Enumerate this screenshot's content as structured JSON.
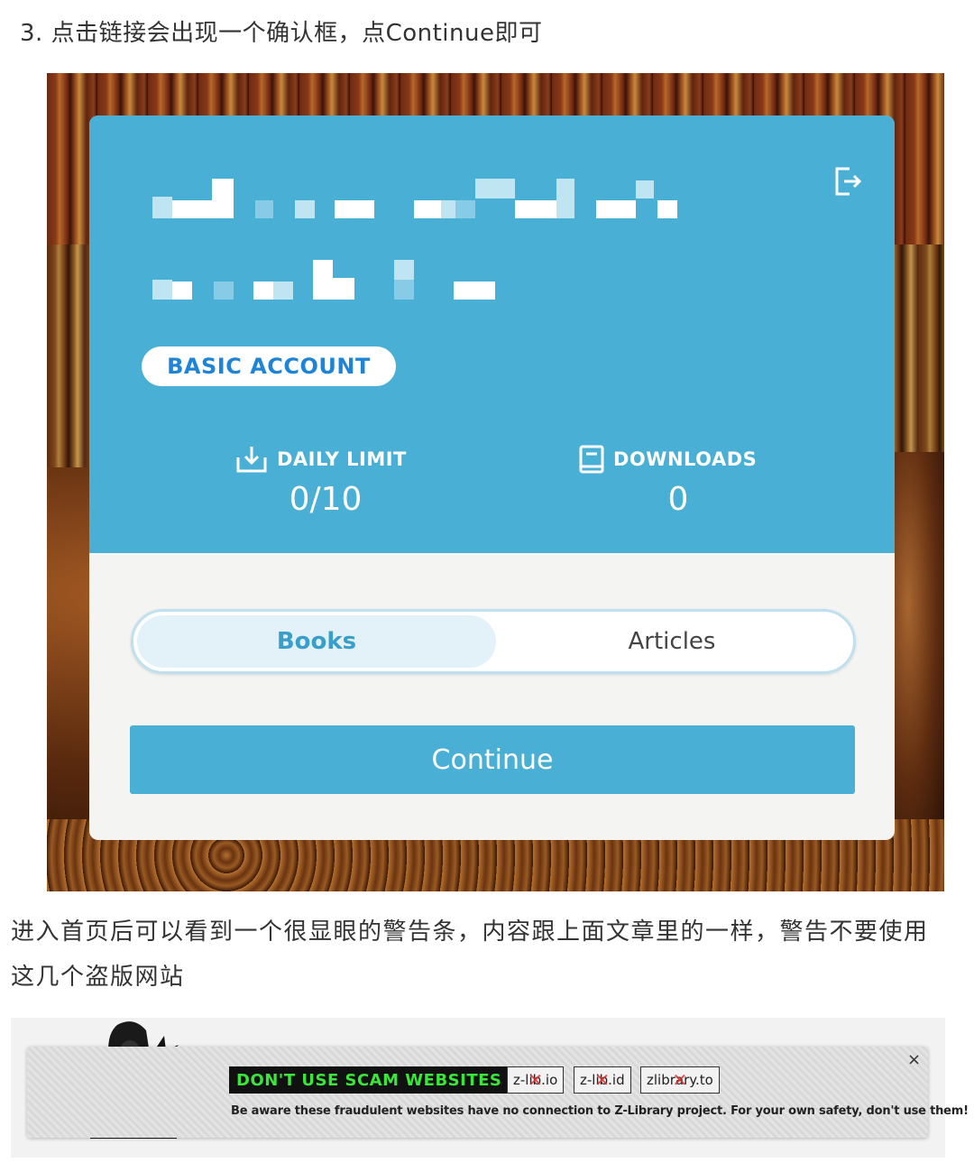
{
  "article": {
    "step_text": "3. 点击链接会出现一个确认框，点Continue即可",
    "paragraph": "进入首页后可以看到一个很显眼的警告条，内容跟上面文章里的一样，警告不要使用这几个盗版网站"
  },
  "dialog": {
    "account_badge": "BASIC ACCOUNT",
    "stats": [
      {
        "label": "DAILY LIMIT",
        "value": "0/10",
        "icon": "download-tray-icon"
      },
      {
        "label": "DOWNLOADS",
        "value": "0",
        "icon": "book-icon"
      }
    ],
    "tabs": [
      {
        "label": "Books",
        "active": true
      },
      {
        "label": "Articles",
        "active": false
      }
    ],
    "continue_label": "Continue",
    "logout_icon": "logout-icon",
    "colors": {
      "accent": "#4aafd4",
      "badge_text": "#1f84d6",
      "card_bottom": "#f4f4f3"
    }
  },
  "warning_banner": {
    "title": "DON'T USE SCAM WEBSITES",
    "domains": [
      "z-lib.io",
      "z-lib.id",
      "zlibrary.to"
    ],
    "message": "Be aware these fraudulent websites have no connection to Z-Library project. For your own safety, don't use them!",
    "close_label": "×",
    "colors": {
      "title_bg": "#111111",
      "title_text": "#39e639"
    }
  }
}
